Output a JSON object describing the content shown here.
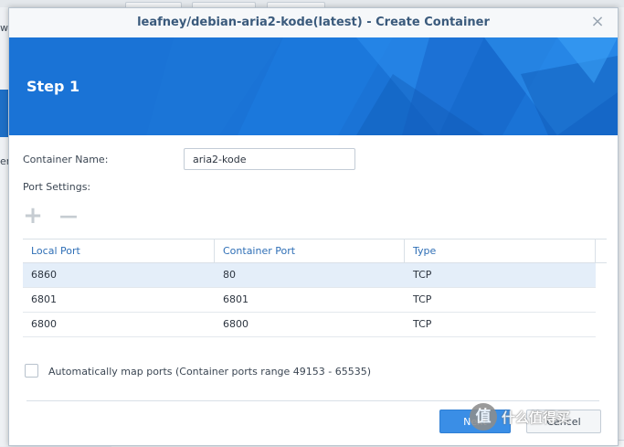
{
  "background": {
    "left_text_1": "w",
    "left_text_2": "er"
  },
  "dialog": {
    "title": "leafney/debian-aria2-kode(latest) - Create Container",
    "close_glyph": "×",
    "banner_title": "Step 1",
    "container_name_label": "Container Name:",
    "container_name_value": "aria2-kode",
    "port_settings_label": "Port Settings:",
    "add_glyph": "+",
    "remove_glyph": "—",
    "table": {
      "headers": [
        "Local Port",
        "Container Port",
        "Type"
      ],
      "rows": [
        {
          "local": "6860",
          "container": "80",
          "type": "TCP"
        },
        {
          "local": "6801",
          "container": "6801",
          "type": "TCP"
        },
        {
          "local": "6800",
          "container": "6800",
          "type": "TCP"
        }
      ]
    },
    "auto_map_label": "Automatically map ports (Container ports range 49153 - 65535)",
    "auto_map_checked": false,
    "next_label": "Next",
    "cancel_label": "Cancel"
  },
  "watermark": {
    "badge": "值",
    "text": "什么值得买"
  },
  "colors": {
    "banner_blue": "#1a73d6",
    "header_blue": "#2f6fb6",
    "selected_row": "#e4eef9",
    "primary_button": "#3a8ee6"
  },
  "icons": [
    "close-icon",
    "add-icon",
    "remove-icon",
    "checkbox-icon"
  ]
}
